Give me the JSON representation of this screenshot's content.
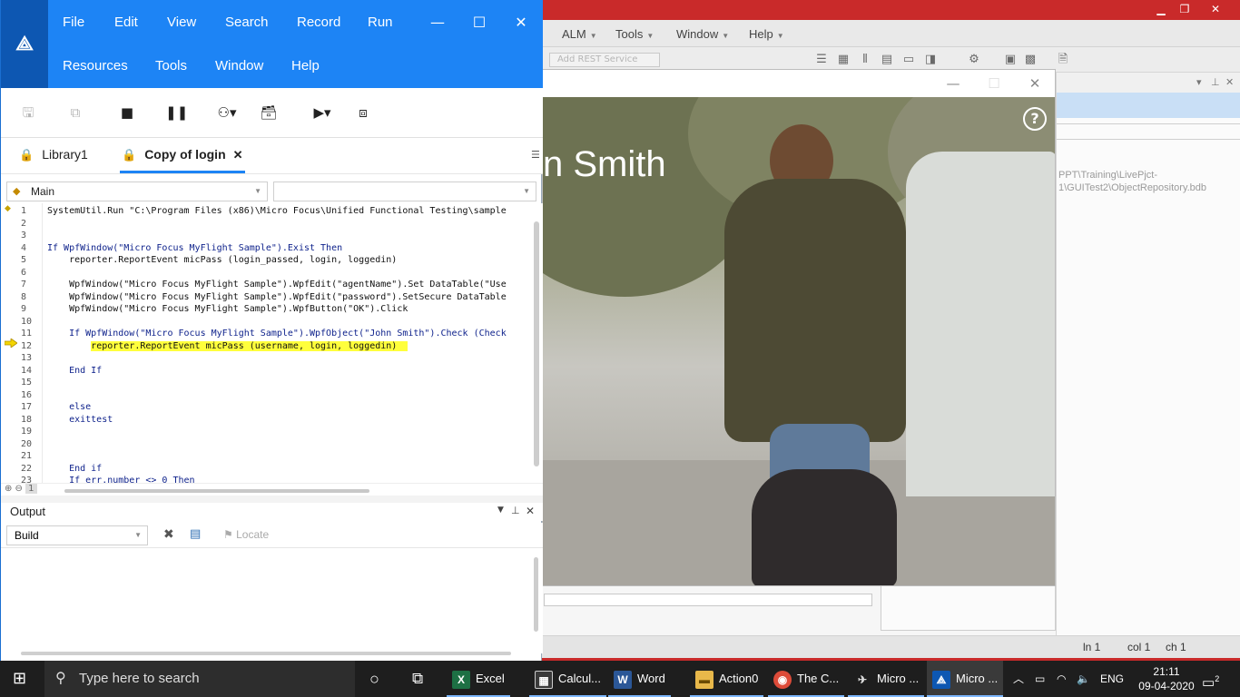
{
  "uft": {
    "menu": [
      "File",
      "Edit",
      "View",
      "Search",
      "Record",
      "Run",
      "Resources",
      "Tools",
      "Window",
      "Help"
    ],
    "tabs": {
      "library": "Library1",
      "active": "Copy of login"
    },
    "combo_left": "Main",
    "code_lines": [
      {
        "n": "1",
        "text": "SystemUtil.Run \"C:\\Program Files (x86)\\Micro Focus\\Unified Functional Testing\\sample"
      },
      {
        "n": "2",
        "text": ""
      },
      {
        "n": "3",
        "text": ""
      },
      {
        "n": "4",
        "text": "If WpfWindow(\"Micro Focus MyFlight Sample\").Exist Then"
      },
      {
        "n": "5",
        "text": "    reporter.ReportEvent micPass (login_passed, login, loggedin)"
      },
      {
        "n": "6",
        "text": ""
      },
      {
        "n": "7",
        "text": "    WpfWindow(\"Micro Focus MyFlight Sample\").WpfEdit(\"agentName\").Set DataTable(\"Use"
      },
      {
        "n": "8",
        "text": "    WpfWindow(\"Micro Focus MyFlight Sample\").WpfEdit(\"password\").SetSecure DataTable"
      },
      {
        "n": "9",
        "text": "    WpfWindow(\"Micro Focus MyFlight Sample\").WpfButton(\"OK\").Click"
      },
      {
        "n": "10",
        "text": ""
      },
      {
        "n": "11",
        "text": "    If WpfWindow(\"Micro Focus MyFlight Sample\").WpfObject(\"John Smith\").Check (Check"
      },
      {
        "n": "12",
        "text": "        reporter.ReportEvent micPass (username, login, loggedin)"
      },
      {
        "n": "13",
        "text": ""
      },
      {
        "n": "14",
        "text": "    End If"
      },
      {
        "n": "15",
        "text": ""
      },
      {
        "n": "16",
        "text": ""
      },
      {
        "n": "17",
        "text": "    else"
      },
      {
        "n": "18",
        "text": "    exittest"
      },
      {
        "n": "19",
        "text": ""
      },
      {
        "n": "20",
        "text": ""
      },
      {
        "n": "21",
        "text": ""
      },
      {
        "n": "22",
        "text": "    End if"
      },
      {
        "n": "23",
        "text": "    If err.number <> 0 Then"
      }
    ],
    "zoom_page": "1",
    "output_title": "Output",
    "output_combo": "Build",
    "locate_label": "Locate"
  },
  "bg_app": {
    "menu": [
      "ALM",
      "Tools",
      "Window",
      "Help"
    ],
    "service_placeholder": "Add REST Service",
    "path_text": "PPT\\Training\\LivePjct-1\\GUITest2\\ObjectRepository.bdb",
    "status": {
      "ln": "ln 1",
      "col": "col 1",
      "ch": "ch 1"
    }
  },
  "dialog": {
    "name_text": "n Smith",
    "help": "?"
  },
  "taskbar": {
    "search_placeholder": "Type here to search",
    "apps": [
      "Excel",
      "Calcul...",
      "Word",
      "Action0",
      "The C...",
      "Micro ...",
      "Micro ..."
    ],
    "lang": "ENG",
    "time": "21:11",
    "date": "09-04-2020",
    "notification_count": "2"
  },
  "colors": {
    "uft_blue": "#1d84f5",
    "uft_logo": "#0d57b2",
    "bg_title_red": "#c92a2a",
    "highlight": "#ffff3c"
  }
}
